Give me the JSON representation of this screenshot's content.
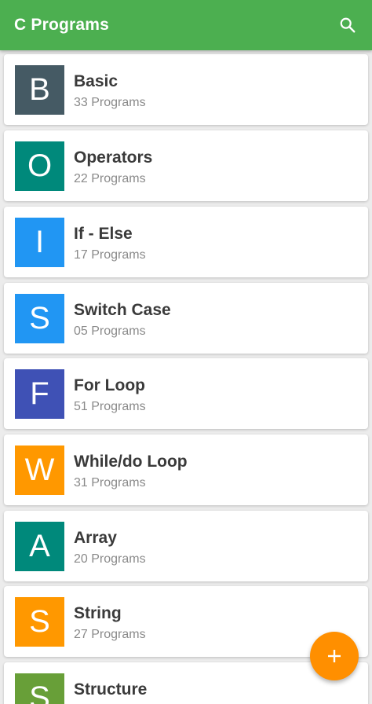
{
  "appbar": {
    "title": "C Programs",
    "color": "#4caf50",
    "search_icon": "search-icon"
  },
  "categories": [
    {
      "letter": "B",
      "title": "Basic",
      "count": "33 Programs",
      "color": "#455a64"
    },
    {
      "letter": "O",
      "title": "Operators",
      "count": "22 Programs",
      "color": "#00897b"
    },
    {
      "letter": "I",
      "title": "If - Else",
      "count": "17 Programs",
      "color": "#2196f3"
    },
    {
      "letter": "S",
      "title": "Switch Case",
      "count": "05 Programs",
      "color": "#2196f3"
    },
    {
      "letter": "F",
      "title": "For Loop",
      "count": "51 Programs",
      "color": "#3f51b5"
    },
    {
      "letter": "W",
      "title": "While/do Loop",
      "count": "31 Programs",
      "color": "#ff9800"
    },
    {
      "letter": "A",
      "title": "Array",
      "count": "20 Programs",
      "color": "#00897b"
    },
    {
      "letter": "S",
      "title": "String",
      "count": "27 Programs",
      "color": "#ff9800"
    },
    {
      "letter": "S",
      "title": "Structure",
      "count": "",
      "color": "#689f38"
    }
  ],
  "fab": {
    "icon": "plus-icon",
    "label": "+",
    "color": "#ff8f00"
  }
}
